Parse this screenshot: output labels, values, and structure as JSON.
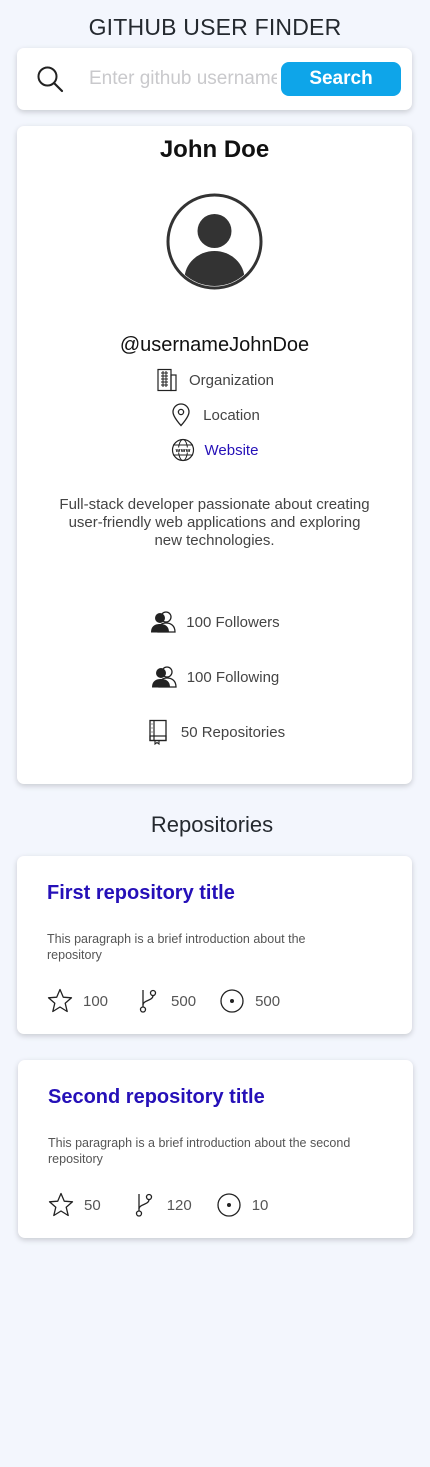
{
  "app": {
    "title": "GITHUB USER FINDER"
  },
  "search": {
    "placeholder": "Enter github username",
    "value": "",
    "button_label": "Search"
  },
  "profile": {
    "name": "John Doe",
    "username": "@usernameJohnDoe",
    "organization": "Organization",
    "location": "Location",
    "website": "Website",
    "bio": "Full-stack developer passionate about creating user-friendly web applications and exploring\nnew technologies.",
    "followers": "100 Followers",
    "following": "100 Following",
    "repositories": "50 Repositories"
  },
  "repos_section": {
    "title": "Repositories"
  },
  "repos": [
    {
      "title": "First repository title",
      "description": "This paragraph is a brief introduction about the repository",
      "stars": "100",
      "forks": "500",
      "issues": "500"
    },
    {
      "title": "Second repository title",
      "description": "This paragraph is a brief introduction about the second repository",
      "stars": "50",
      "forks": "120",
      "issues": "10"
    }
  ],
  "colors": {
    "accent": "#0ea5e9",
    "link": "#2510b8",
    "background": "#f3f6fd"
  }
}
